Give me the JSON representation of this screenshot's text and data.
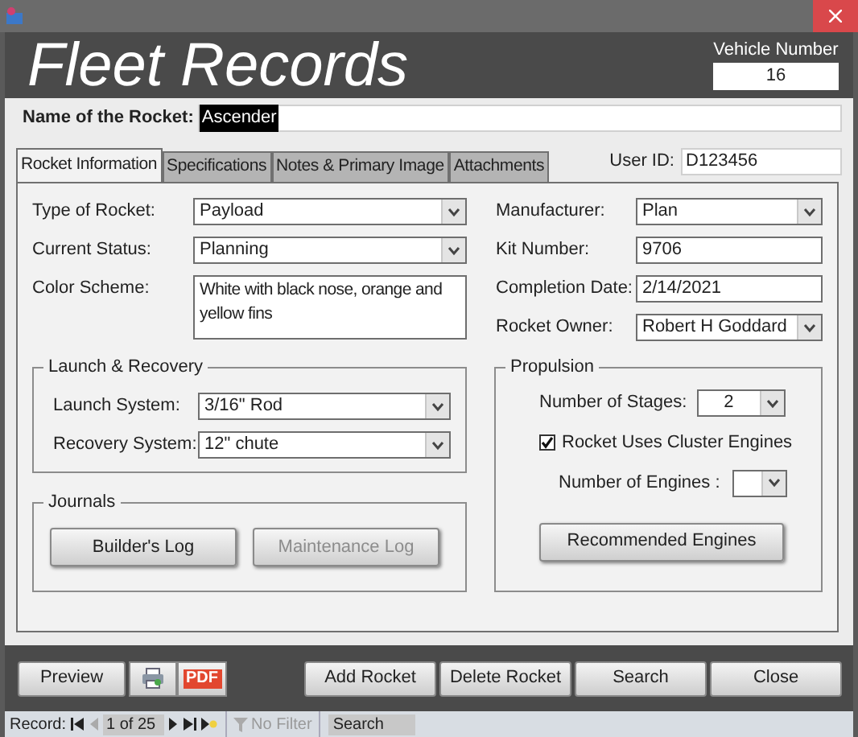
{
  "header": {
    "title": "Fleet Records",
    "vehicle_number": {
      "label": "Vehicle Number",
      "value": "16"
    }
  },
  "name_field": {
    "label": "Name of the Rocket:",
    "value": "Ascender",
    "highlighted": true
  },
  "tabs": [
    {
      "label": "Rocket Information",
      "selected": true
    },
    {
      "label": "Specifications",
      "selected": false
    },
    {
      "label": "Notes & Primary Image",
      "selected": false
    },
    {
      "label": "Attachments",
      "selected": false
    }
  ],
  "user_id": {
    "label": "User ID:",
    "value": "D123456"
  },
  "fields_left": [
    {
      "label": "Type of Rocket:",
      "value": "Payload",
      "kind": "dropdown"
    },
    {
      "label": "Current Status:",
      "value": "Planning",
      "kind": "dropdown"
    },
    {
      "label": "Color Scheme:",
      "value": "White with black nose, orange and yellow fins",
      "kind": "memo"
    }
  ],
  "fields_right": [
    {
      "label": "Manufacturer:",
      "value": "Plan",
      "kind": "dropdown"
    },
    {
      "label": "Kit Number:",
      "value": "9706",
      "kind": "text"
    },
    {
      "label": "Completion Date:",
      "value": "2/14/2021",
      "kind": "text"
    },
    {
      "label": "Rocket Owner:",
      "value": "Robert H Goddard",
      "kind": "dropdown"
    }
  ],
  "launch_recovery": {
    "title": "Launch & Recovery",
    "fields": [
      {
        "label": "Launch System:",
        "value": "3/16\" Rod",
        "kind": "dropdown"
      },
      {
        "label": "Recovery System:",
        "value": "12\" chute",
        "kind": "dropdown"
      }
    ]
  },
  "journals": {
    "title": "Journals",
    "buttons": [
      {
        "label": "Builder's Log",
        "disabled": false
      },
      {
        "label": "Maintenance Log",
        "disabled": true
      }
    ]
  },
  "propulsion": {
    "title": "Propulsion",
    "stages": {
      "label": "Number of Stages:",
      "value": "2"
    },
    "cluster": {
      "label": "Rocket Uses Cluster Engines",
      "checked": true
    },
    "engines": {
      "label": "Number of Engines :"
    },
    "button": {
      "label": "Recommended Engines"
    }
  },
  "footer_buttons": [
    {
      "kind": "text",
      "label": "Preview"
    },
    {
      "kind": "print"
    },
    {
      "kind": "pdf",
      "label": "PDF"
    },
    {
      "kind": "spacer"
    },
    {
      "kind": "text",
      "label": "Add Rocket"
    },
    {
      "kind": "text",
      "label": "Delete Rocket"
    },
    {
      "kind": "text",
      "label": "Search"
    },
    {
      "kind": "text",
      "label": "Close"
    }
  ],
  "status_bar": {
    "record_label": "Record:",
    "position": "1 of 25",
    "filter": "No Filter",
    "search": "Search"
  }
}
